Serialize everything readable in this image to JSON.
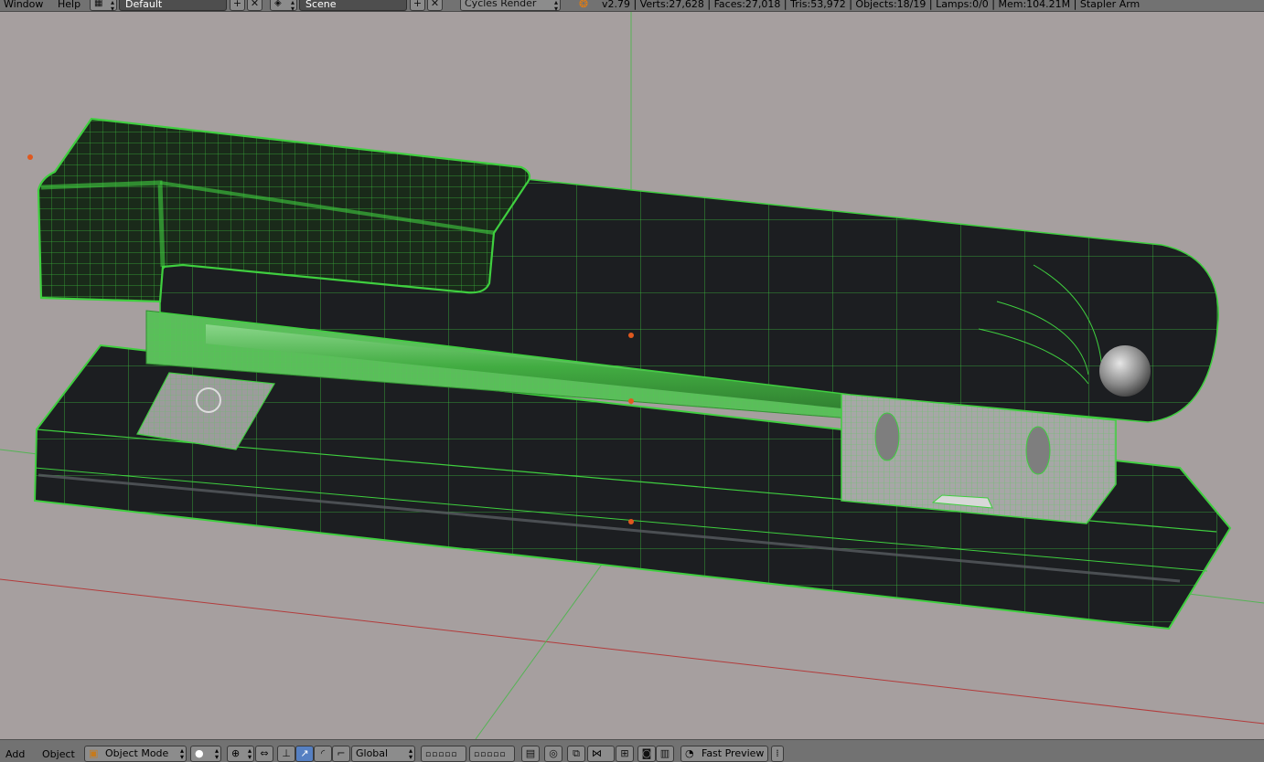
{
  "topbar": {
    "menus": [
      "Window",
      "Help"
    ],
    "screen_layout": "Default",
    "scene": "Scene",
    "render_engine": "Cycles Render",
    "stats": "v2.79 | Verts:27,628 | Faces:27,018 | Tris:53,972 | Objects:18/19 | Lamps:0/0 | Mem:104.21M | Stapler Arm"
  },
  "viewport": {
    "background": "#a69f9f",
    "wire_color": "#3fcf3f",
    "mesh_color": "#1c1e21",
    "object_name": "Stapler Arm"
  },
  "bottombar": {
    "menus": [
      "Add",
      "Object"
    ],
    "mode": "Object Mode",
    "orientation": "Global",
    "render_preview": "Fast Preview"
  },
  "colors": {
    "header_bg": "#727272",
    "field_bg": "#4e4e4e",
    "active_button": "#5680c2",
    "origin_dot": "#e0581e",
    "x_axis": "#b33b3b",
    "y_axis": "#55b355"
  },
  "icons": [
    "layout-icon",
    "scene-icon",
    "add-icon",
    "close-icon",
    "blender-logo-icon",
    "mode-cube-icon",
    "shading-sphere-icon",
    "pivot-icon",
    "manipulator-icon",
    "translate-icon",
    "rotate-icon",
    "scale-icon",
    "layers-icon",
    "lock-icon",
    "proportional-icon",
    "snap-icon",
    "render-icon",
    "camera-icon",
    "preview-icon"
  ]
}
